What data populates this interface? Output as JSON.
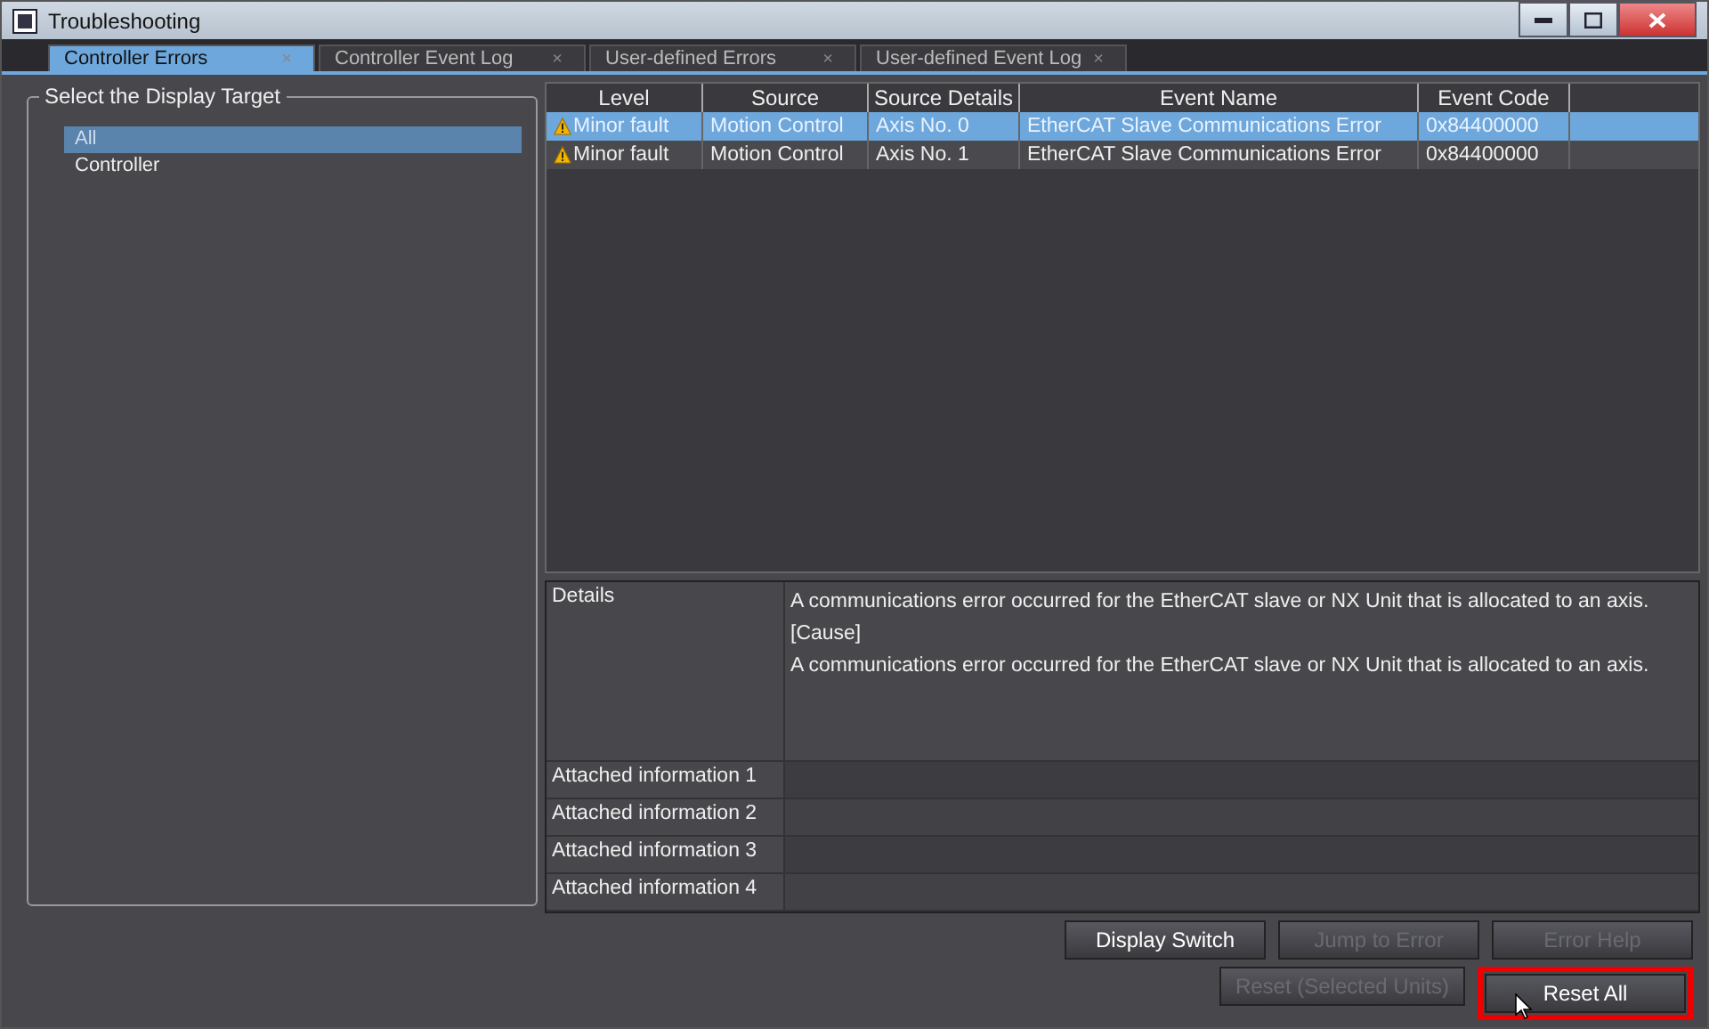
{
  "window": {
    "title": "Troubleshooting"
  },
  "tabs": [
    {
      "label": "Controller Errors",
      "close": "×",
      "selected": true
    },
    {
      "label": "Controller Event Log",
      "close": "×",
      "selected": false
    },
    {
      "label": "User-defined Errors",
      "close": "×",
      "selected": false
    },
    {
      "label": "User-defined Event Log",
      "close": "×",
      "selected": false
    }
  ],
  "target": {
    "title": "Select the Display Target",
    "items": [
      {
        "label": "All",
        "selected": true
      },
      {
        "label": "Controller",
        "selected": false
      }
    ]
  },
  "table": {
    "columns": [
      "Level",
      "Source",
      "Source Details",
      "Event Name",
      "Event Code"
    ],
    "rows": [
      {
        "selected": true,
        "cells": [
          "Minor fault",
          "Motion Control",
          "Axis No. 0",
          "EtherCAT Slave Communications Error",
          "0x84400000"
        ]
      },
      {
        "selected": false,
        "cells": [
          "Minor fault",
          "Motion Control",
          "Axis No. 1",
          "EtherCAT Slave Communications Error",
          "0x84400000"
        ]
      }
    ]
  },
  "details": [
    {
      "label": "Details",
      "lines": [
        "A communications error occurred for the EtherCAT slave or NX Unit that is allocated to an axis.",
        "[Cause]",
        "A communications error occurred for the EtherCAT slave or NX Unit that is allocated to an axis."
      ]
    },
    {
      "label": "Attached information 1"
    },
    {
      "label": "Attached information 2"
    },
    {
      "label": "Attached information 3"
    },
    {
      "label": "Attached information 4"
    }
  ],
  "button_rows": [
    [
      {
        "label": "Display Switch",
        "disabled": false,
        "highlighted": false
      },
      {
        "label": "Jump to Error",
        "disabled": true,
        "highlighted": false
      },
      {
        "label": "Error Help",
        "disabled": true,
        "highlighted": false
      }
    ],
    [
      {
        "label": "Reset (Selected Units)",
        "disabled": true,
        "highlighted": false
      },
      {
        "label": "Reset All",
        "disabled": false,
        "highlighted": true
      }
    ]
  ]
}
